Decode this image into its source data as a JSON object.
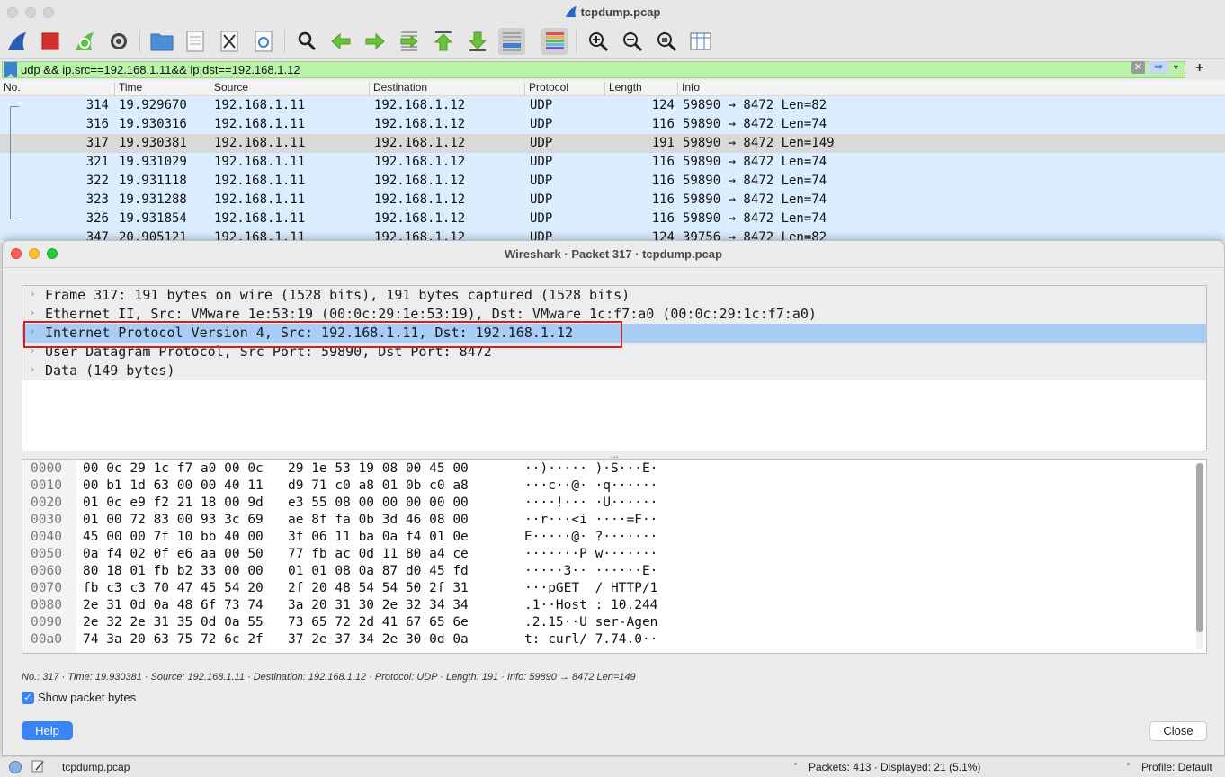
{
  "window": {
    "title": "tcpdump.pcap"
  },
  "toolbar": {
    "buttons": [
      {
        "name": "start-capture-icon",
        "color": "#2a5db0"
      },
      {
        "name": "stop-capture-icon",
        "color": "#d32f2f"
      },
      {
        "name": "restart-capture-icon",
        "color": "#4caf50"
      },
      {
        "name": "capture-options-icon",
        "color": "#333333"
      },
      {
        "name": "open-file-icon",
        "color": "#4a90d9"
      },
      {
        "name": "save-file-icon",
        "color": "#888888"
      },
      {
        "name": "close-file-icon",
        "color": "#555555"
      },
      {
        "name": "reload-file-icon",
        "color": "#3a7fd6"
      },
      {
        "name": "find-packet-icon",
        "color": "#333333"
      },
      {
        "name": "go-back-icon",
        "color": "#5cb82a"
      },
      {
        "name": "go-forward-icon",
        "color": "#5cb82a"
      },
      {
        "name": "go-to-packet-icon",
        "color": "#5cb82a"
      },
      {
        "name": "go-first-icon",
        "color": "#5cb82a"
      },
      {
        "name": "go-last-icon",
        "color": "#5cb82a"
      },
      {
        "name": "auto-scroll-icon",
        "color": "#555555"
      },
      {
        "name": "colorize-icon",
        "color": "#555555"
      },
      {
        "name": "zoom-in-icon",
        "color": "#333333"
      },
      {
        "name": "zoom-out-icon",
        "color": "#333333"
      },
      {
        "name": "normal-size-icon",
        "color": "#333333"
      },
      {
        "name": "resize-columns-icon",
        "color": "#555555"
      }
    ]
  },
  "filter": {
    "value": "udp && ip.src==192.168.1.11&& ip.dst==192.168.1.12",
    "plus_label": "+"
  },
  "packet_list": {
    "columns": [
      "No.",
      "Time",
      "Source",
      "Destination",
      "Protocol",
      "Length",
      "Info"
    ],
    "rows": [
      {
        "no": "314",
        "time": "19.929670",
        "src": "192.168.1.11",
        "dst": "192.168.1.12",
        "proto": "UDP",
        "len": "124",
        "info": "59890 → 8472 Len=82"
      },
      {
        "no": "316",
        "time": "19.930316",
        "src": "192.168.1.11",
        "dst": "192.168.1.12",
        "proto": "UDP",
        "len": "116",
        "info": "59890 → 8472 Len=74"
      },
      {
        "no": "317",
        "time": "19.930381",
        "src": "192.168.1.11",
        "dst": "192.168.1.12",
        "proto": "UDP",
        "len": "191",
        "info": "59890 → 8472 Len=149"
      },
      {
        "no": "321",
        "time": "19.931029",
        "src": "192.168.1.11",
        "dst": "192.168.1.12",
        "proto": "UDP",
        "len": "116",
        "info": "59890 → 8472 Len=74"
      },
      {
        "no": "322",
        "time": "19.931118",
        "src": "192.168.1.11",
        "dst": "192.168.1.12",
        "proto": "UDP",
        "len": "116",
        "info": "59890 → 8472 Len=74"
      },
      {
        "no": "323",
        "time": "19.931288",
        "src": "192.168.1.11",
        "dst": "192.168.1.12",
        "proto": "UDP",
        "len": "116",
        "info": "59890 → 8472 Len=74"
      },
      {
        "no": "326",
        "time": "19.931854",
        "src": "192.168.1.11",
        "dst": "192.168.1.12",
        "proto": "UDP",
        "len": "116",
        "info": "59890 → 8472 Len=74"
      },
      {
        "no": "347",
        "time": "20.905121",
        "src": "192.168.1.11",
        "dst": "192.168.1.12",
        "proto": "UDP",
        "len": "124",
        "info": "39756 → 8472 Len=82"
      }
    ]
  },
  "dialog": {
    "title": "Wireshark · Packet 317 · tcpdump.pcap",
    "tree": [
      "Frame 317: 191 bytes on wire (1528 bits), 191 bytes captured (1528 bits)",
      "Ethernet II, Src: VMware_1e:53:19 (00:0c:29:1e:53:19), Dst: VMware_1c:f7:a0 (00:0c:29:1c:f7:a0)",
      "Internet Protocol Version 4, Src: 192.168.1.11, Dst: 192.168.1.12",
      "User Datagram Protocol, Src Port: 59890, Dst Port: 8472",
      "Data (149 bytes)"
    ],
    "hex": [
      {
        "off": "0000",
        "a": "00 0c 29 1c f7 a0 00 0c",
        "b": "29 1e 53 19 08 00 45 00",
        "ascii": "··)····· )·S···E·"
      },
      {
        "off": "0010",
        "a": "00 b1 1d 63 00 00 40 11",
        "b": "d9 71 c0 a8 01 0b c0 a8",
        "ascii": "···c··@· ·q······"
      },
      {
        "off": "0020",
        "a": "01 0c e9 f2 21 18 00 9d",
        "b": "e3 55 08 00 00 00 00 00",
        "ascii": "····!··· ·U······"
      },
      {
        "off": "0030",
        "a": "01 00 72 83 00 93 3c 69",
        "b": "ae 8f fa 0b 3d 46 08 00",
        "ascii": "··r···<i ····=F··"
      },
      {
        "off": "0040",
        "a": "45 00 00 7f 10 bb 40 00",
        "b": "3f 06 11 ba 0a f4 01 0e",
        "ascii": "E·····@· ?·······"
      },
      {
        "off": "0050",
        "a": "0a f4 02 0f e6 aa 00 50",
        "b": "77 fb ac 0d 11 80 a4 ce",
        "ascii": "·······P w·······"
      },
      {
        "off": "0060",
        "a": "80 18 01 fb b2 33 00 00",
        "b": "01 01 08 0a 87 d0 45 fd",
        "ascii": "·····3·· ······E·"
      },
      {
        "off": "0070",
        "a": "fb c3 c3 70 47 45 54 20",
        "b": "2f 20 48 54 54 50 2f 31",
        "ascii": "···pGET  / HTTP/1"
      },
      {
        "off": "0080",
        "a": "2e 31 0d 0a 48 6f 73 74",
        "b": "3a 20 31 30 2e 32 34 34",
        "ascii": ".1··Host : 10.244"
      },
      {
        "off": "0090",
        "a": "2e 32 2e 31 35 0d 0a 55",
        "b": "73 65 72 2d 41 67 65 6e",
        "ascii": ".2.15··U ser-Agen"
      },
      {
        "off": "00a0",
        "a": "74 3a 20 63 75 72 6c 2f",
        "b": "37 2e 37 34 2e 30 0d 0a",
        "ascii": "t: curl/ 7.74.0··"
      }
    ],
    "status": "No.: 317 · Time: 19.930381 · Source: 192.168.1.11 · Destination: 192.168.1.12 · Protocol: UDP · Length: 191 · Info: 59890 → 8472 Len=149",
    "show_bytes_label": "Show packet bytes",
    "show_bytes_checked": true,
    "help_label": "Help",
    "close_label": "Close"
  },
  "statusbar": {
    "file": "tcpdump.pcap",
    "packets": "Packets: 413 · Displayed: 21 (5.1%)",
    "profile": "Profile: Default"
  },
  "colors": {
    "row_bg": "#daeeff",
    "selected_row_bg": "#d9d9d9",
    "tree_selected_bg": "#a8cdf6",
    "filter_valid_bg": "#b8f3a8",
    "highlight_border": "#d21f1f",
    "accent": "#3a83f4"
  }
}
